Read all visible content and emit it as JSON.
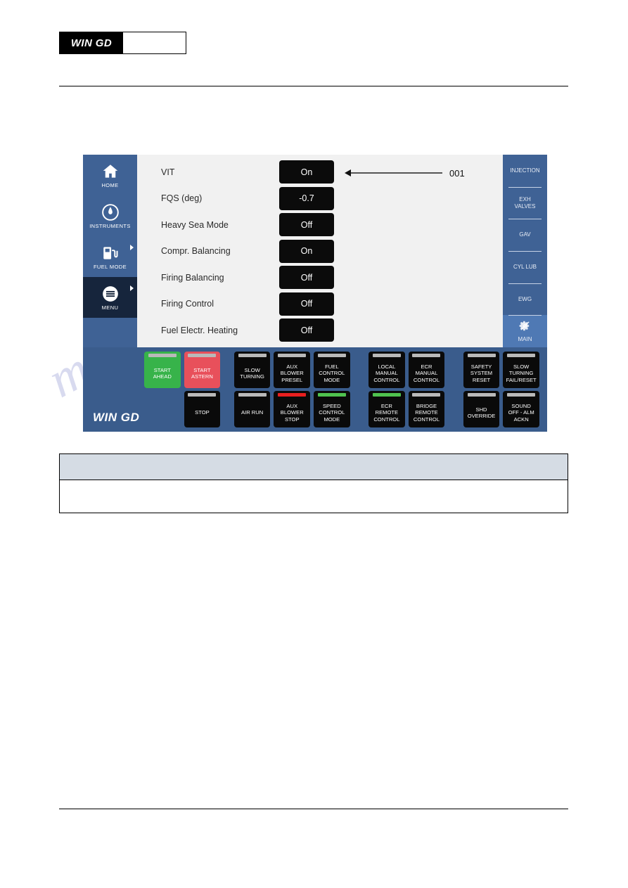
{
  "document": {
    "logo_text": "WIN GD",
    "watermark_text": "manualshive.com"
  },
  "hmi": {
    "brand": "WIN GD",
    "left_nav": [
      {
        "label": "HOME",
        "icon": "home-icon",
        "active": false,
        "has_arrow": false
      },
      {
        "label": "INSTRUMENTS",
        "icon": "gauge-icon",
        "active": false,
        "has_arrow": false
      },
      {
        "label": "FUEL MODE",
        "icon": "fuel-pump-icon",
        "active": false,
        "has_arrow": true
      },
      {
        "label": "MENU",
        "icon": "hamburger-icon",
        "active": true,
        "has_arrow": true
      }
    ],
    "settings": [
      {
        "label": "VIT",
        "value": "On"
      },
      {
        "label": "FQS (deg)",
        "value": "-0.7"
      },
      {
        "label": "Heavy Sea Mode",
        "value": "Off"
      },
      {
        "label": "Compr. Balancing",
        "value": "On"
      },
      {
        "label": "Firing Balancing",
        "value": "Off"
      },
      {
        "label": "Firing Control",
        "value": "Off"
      },
      {
        "label": "Fuel Electr. Heating",
        "value": "Off"
      }
    ],
    "callout": {
      "number": "001"
    },
    "right_nav": [
      {
        "label": "INJECTION",
        "active": false,
        "icon": null
      },
      {
        "label": "EXH\nVALVES",
        "active": false,
        "icon": null
      },
      {
        "label": "GAV",
        "active": false,
        "icon": null
      },
      {
        "label": "CYL LUB",
        "active": false,
        "icon": null
      },
      {
        "label": "EWG",
        "active": false,
        "icon": null
      },
      {
        "label": "MAIN",
        "active": true,
        "icon": "gear-icon"
      }
    ],
    "buttons_row1": [
      {
        "label": "START\nAHEAD",
        "body": "green",
        "led": "gray"
      },
      {
        "label": "START\nASTERN",
        "body": "red",
        "led": "gray"
      },
      {
        "gap": "s"
      },
      {
        "label": "SLOW\nTURNING",
        "body": "black",
        "led": "gray"
      },
      {
        "label": "AUX\nBLOWER\nPRESEL",
        "body": "black",
        "led": "gray"
      },
      {
        "label": "FUEL\nCONTROL\nMODE",
        "body": "black",
        "led": "gray"
      },
      {
        "gap": "m"
      },
      {
        "label": "LOCAL\nMANUAL\nCONTROL",
        "body": "black",
        "led": "gray"
      },
      {
        "label": "ECR\nMANUAL\nCONTROL",
        "body": "black",
        "led": "gray"
      },
      {
        "gap": "m"
      },
      {
        "label": "SAFETY\nSYSTEM\nRESET",
        "body": "black",
        "led": "gray"
      },
      {
        "label": "SLOW\nTURNING\nFAIL/RESET",
        "body": "black",
        "led": "gray"
      }
    ],
    "buttons_row2": [
      {
        "label": "",
        "body": "blank",
        "led": "none"
      },
      {
        "label": "STOP",
        "body": "black",
        "led": "gray"
      },
      {
        "gap": "s"
      },
      {
        "label": "AIR RUN",
        "body": "black",
        "led": "gray"
      },
      {
        "label": "AUX\nBLOWER\nSTOP",
        "body": "black",
        "led": "red"
      },
      {
        "label": "SPEED\nCONTROL\nMODE",
        "body": "black",
        "led": "green"
      },
      {
        "gap": "m"
      },
      {
        "label": "ECR\nREMOTE\nCONTROL",
        "body": "black",
        "led": "green"
      },
      {
        "label": "BRIDGE\nREMOTE\nCONTROL",
        "body": "black",
        "led": "gray"
      },
      {
        "gap": "m"
      },
      {
        "label": "SHD\nOVERRIDE",
        "body": "black",
        "led": "gray"
      },
      {
        "label": "SOUND\nOFF - ALM\nACKN",
        "body": "black",
        "led": "gray"
      }
    ],
    "colors": {
      "panel_blue": "#3a5c8c",
      "nav_blue": "#3f6295",
      "nav_active": "#16253c",
      "tab_active": "#4f79b4",
      "content_bg": "#f1f1f1",
      "value_black": "#0b0b0b",
      "start_ahead_green": "#37b34a",
      "start_astern_red": "#e8505b",
      "led_green": "#4fc24f",
      "led_red": "#e81f1f",
      "led_gray": "#b9b9b9"
    }
  },
  "caption_table": {
    "header_text": "",
    "body_text": ""
  }
}
